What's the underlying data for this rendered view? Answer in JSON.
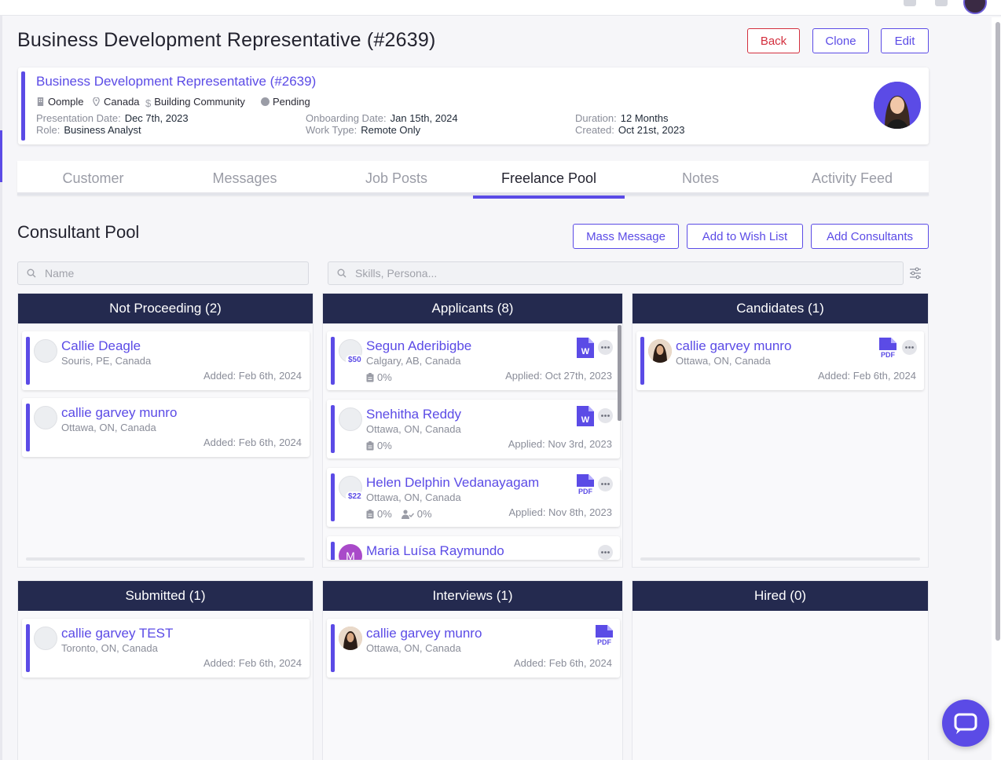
{
  "header": {
    "title": "Business Development Representative (#2639)",
    "buttons": {
      "back": "Back",
      "clone": "Clone",
      "edit": "Edit"
    }
  },
  "summary": {
    "job_title": "Business Development Representative (#2639)",
    "company": "Oomple",
    "country": "Canada",
    "category": "Building Community",
    "status": "Pending",
    "presentation_date_label": "Presentation Date:",
    "presentation_date": "Dec 7th, 2023",
    "role_label": "Role:",
    "role": "Business Analyst",
    "onboarding_date_label": "Onboarding Date:",
    "onboarding_date": "Jan 15th, 2024",
    "work_type_label": "Work Type:",
    "work_type": "Remote Only",
    "duration_label": "Duration:",
    "duration": "12 Months",
    "created_label": "Created:",
    "created": "Oct 21st, 2023"
  },
  "tabs": [
    {
      "label": "Customer"
    },
    {
      "label": "Messages"
    },
    {
      "label": "Job Posts"
    },
    {
      "label": "Freelance Pool",
      "active": true
    },
    {
      "label": "Notes"
    },
    {
      "label": "Activity Feed"
    }
  ],
  "pool": {
    "title": "Consultant Pool",
    "buttons": {
      "mass_message": "Mass Message",
      "add_wish": "Add to Wish List",
      "add_consultants": "Add Consultants"
    },
    "name_placeholder": "Name",
    "skills_placeholder": "Skills, Persona..."
  },
  "columns": {
    "not_proceeding": {
      "title": "Not Proceeding (2)",
      "cards": [
        {
          "name": "Callie Deagle",
          "location": "Souris, PE, Canada",
          "date": "Added: Feb 6th, 2024"
        },
        {
          "name": "callie garvey munro",
          "location": "Ottawa, ON, Canada",
          "date": "Added: Feb 6th, 2024"
        }
      ]
    },
    "applicants": {
      "title": "Applicants (8)",
      "cards": [
        {
          "name": "Segun Aderibigbe",
          "location": "Calgary, AB, Canada",
          "date": "Applied: Oct 27th, 2023",
          "rate": "$50",
          "match": "0%",
          "doc": "word"
        },
        {
          "name": "Snehitha Reddy",
          "location": "Ottawa, ON, Canada",
          "date": "Applied: Nov 3rd, 2023",
          "match": "0%",
          "doc": "word"
        },
        {
          "name": "Helen Delphin Vedanayagam",
          "location": "Ottawa, ON, Canada",
          "date": "Applied: Nov 8th, 2023",
          "rate": "$22",
          "match": "0%",
          "persona": "0%",
          "doc": "pdf"
        },
        {
          "name": "Maria Luísa Raymundo",
          "initial": "M"
        }
      ]
    },
    "candidates": {
      "title": "Candidates (1)",
      "cards": [
        {
          "name": "callie garvey munro",
          "location": "Ottawa, ON, Canada",
          "date": "Added: Feb 6th, 2024",
          "doc": "pdf"
        }
      ]
    },
    "submitted": {
      "title": "Submitted (1)",
      "cards": [
        {
          "name": "callie garvey TEST",
          "location": "Toronto, ON, Canada",
          "date": "Added: Feb 6th, 2024"
        }
      ]
    },
    "interviews": {
      "title": "Interviews (1)",
      "cards": [
        {
          "name": "callie garvey munro",
          "location": "Ottawa, ON, Canada",
          "date": "Added: Feb 6th, 2024",
          "doc": "pdf"
        }
      ]
    },
    "hired": {
      "title": "Hired (0)",
      "cards": []
    }
  },
  "colors": {
    "accent": "#5b4be6",
    "column_header": "#242a4f",
    "danger": "#d32f3e"
  },
  "doc_labels": {
    "word": "W",
    "pdf": "PDF"
  }
}
